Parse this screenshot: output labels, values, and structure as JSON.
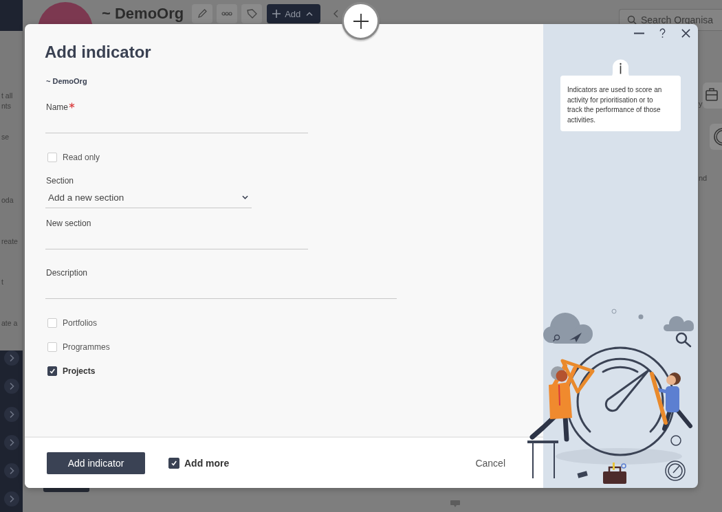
{
  "background": {
    "header": {
      "org_title": "~ DemoOrg",
      "add_label": "Add",
      "search": {
        "placeholder": "Search Organisa"
      }
    },
    "side_panel": {
      "fragments": [
        "t all",
        "nts",
        "se",
        "oda",
        "reate",
        "t",
        "ate a"
      ]
    },
    "right_strip": {
      "fragments": [
        "y",
        "nd"
      ]
    }
  },
  "dialog": {
    "title": "Add indicator",
    "org": "~ DemoOrg",
    "fields": [
      {
        "kind": "text",
        "label": "Name",
        "required": true
      },
      {
        "kind": "checkbox",
        "label": "Read only",
        "checked": false
      },
      {
        "kind": "select",
        "label": "Section",
        "value": "Add a new section"
      },
      {
        "kind": "text",
        "label": "New section",
        "required": false
      },
      {
        "kind": "multiline",
        "label": "Description",
        "required": false
      }
    ],
    "apply_to": [
      {
        "label": "Portfolios",
        "checked": false
      },
      {
        "label": "Programmes",
        "checked": false
      },
      {
        "label": "Projects",
        "checked": true
      }
    ],
    "help": {
      "text": "Indicators are used to score an activity for prioritisation or to track the performance of those activities."
    },
    "footer": {
      "submit": "Add indicator",
      "add_more": {
        "label": "Add more",
        "checked": true
      },
      "cancel": "Cancel"
    }
  }
}
